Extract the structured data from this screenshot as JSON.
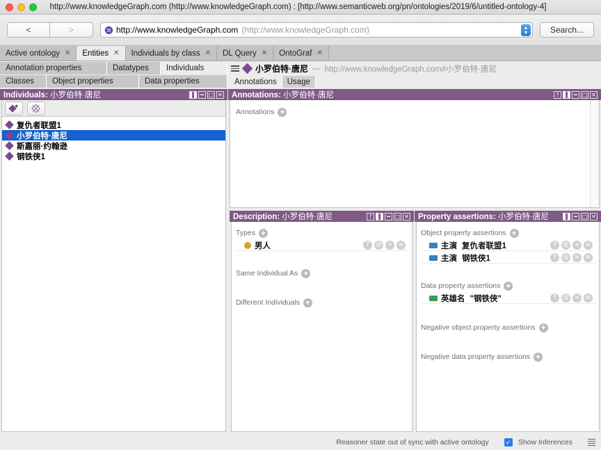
{
  "window": {
    "title": "http://www.knowledgeGraph.com (http://www.knowledgeGraph.com)  : [http://www.semanticweb.org/pn/ontologies/2019/6/untitled-ontology-4]",
    "traffic_lights": [
      "close-button",
      "minimize-button",
      "zoom-button"
    ]
  },
  "toolbar": {
    "back_label": "<",
    "forward_label": ">",
    "url_value": "http://www.knowledgeGraph.com",
    "url_secondary": "(http://www.knowledgeGraph.com)",
    "search_label": "Search..."
  },
  "workspace_tabs": [
    {
      "label": "Active ontology",
      "active": false
    },
    {
      "label": "Entities",
      "active": true
    },
    {
      "label": "Individuals by class",
      "active": false
    },
    {
      "label": "DL Query",
      "active": false
    },
    {
      "label": "OntoGraf",
      "active": false
    }
  ],
  "entity_tabs": {
    "row1": [
      {
        "label": "Annotation properties",
        "active": false
      },
      {
        "label": "Datatypes",
        "active": false
      },
      {
        "label": "Individuals",
        "active": true
      }
    ],
    "row2": [
      {
        "label": "Classes",
        "active": false
      },
      {
        "label": "Object properties",
        "active": false
      },
      {
        "label": "Data properties",
        "active": false
      }
    ]
  },
  "entity_header": {
    "name": "小罗伯特·唐尼",
    "dash": "—",
    "uri": "http://www.knowledgeGraph.com#小罗伯特·唐尼",
    "tabs": [
      {
        "label": "Annotations",
        "active": true
      },
      {
        "label": "Usage",
        "active": false
      }
    ]
  },
  "individuals_panel": {
    "title": "Individuals:",
    "subject": "小罗伯特·唐尼",
    "window_buttons": [
      "split-button",
      "minimize-button",
      "maximize-button",
      "close-button"
    ],
    "toolbar_icons": [
      "add-individual-icon",
      "delete-individual-icon"
    ],
    "items": [
      {
        "label": "复仇者联盟1",
        "selected": false
      },
      {
        "label": "小罗伯特·唐尼",
        "selected": true
      },
      {
        "label": "斯嘉丽·约翰逊",
        "selected": false
      },
      {
        "label": "钢铁侠1",
        "selected": false
      }
    ]
  },
  "annotations_panel": {
    "title": "Annotations:",
    "subject": "小罗伯特·唐尼",
    "window_buttons": [
      "help-button",
      "split-button",
      "minimize-button",
      "maximize-button",
      "close-button"
    ],
    "section_label": "Annotations",
    "items": []
  },
  "description_panel": {
    "title": "Description:",
    "subject": "小罗伯特·唐尼",
    "window_buttons": [
      "help-button",
      "split-button",
      "minimize-button",
      "maximize-button",
      "close-button"
    ],
    "groups": [
      {
        "label": "Types",
        "entries": [
          {
            "icon": "class-dot-icon",
            "text": "男人",
            "actions": [
              "?",
              "@",
              "×",
              "o"
            ]
          }
        ]
      },
      {
        "label": "Same Individual As",
        "entries": []
      },
      {
        "label": "Different Individuals",
        "entries": []
      }
    ]
  },
  "assertions_panel": {
    "title": "Property assertions:",
    "subject": "小罗伯特·唐尼",
    "window_buttons": [
      "split-button",
      "minimize-button",
      "maximize-button",
      "close-button"
    ],
    "groups": [
      {
        "label": "Object property assertions",
        "entries": [
          {
            "icon": "object-property-icon",
            "property": "主演",
            "value": "复仇者联盟1",
            "actions": [
              "?",
              "@",
              "×",
              "o"
            ]
          },
          {
            "icon": "object-property-icon",
            "property": "主演",
            "value": "钢铁侠1",
            "actions": [
              "?",
              "@",
              "×",
              "o"
            ]
          }
        ]
      },
      {
        "label": "Data property assertions",
        "entries": [
          {
            "icon": "data-property-icon",
            "property": "英雄名",
            "value": "\"钢铁侠\"",
            "actions": [
              "?",
              "@",
              "×",
              "o"
            ]
          }
        ]
      },
      {
        "label": "Negative object property assertions",
        "entries": []
      },
      {
        "label": "Negative data property assertions",
        "entries": []
      }
    ]
  },
  "statusbar": {
    "reasoner_state": "Reasoner state out of sync with active ontology",
    "show_inferences_label": "Show Inferences",
    "show_inferences_checked": true,
    "menu_icon": "list-icon"
  },
  "colors": {
    "panel_header": "#7e5a85",
    "selection": "#1461d2",
    "individual_diamond": "#7a4a8e",
    "class_dot": "#d6a621",
    "object_property": "#3b7ec4",
    "data_property": "#3f9b4e",
    "checkbox": "#2a7bea"
  }
}
